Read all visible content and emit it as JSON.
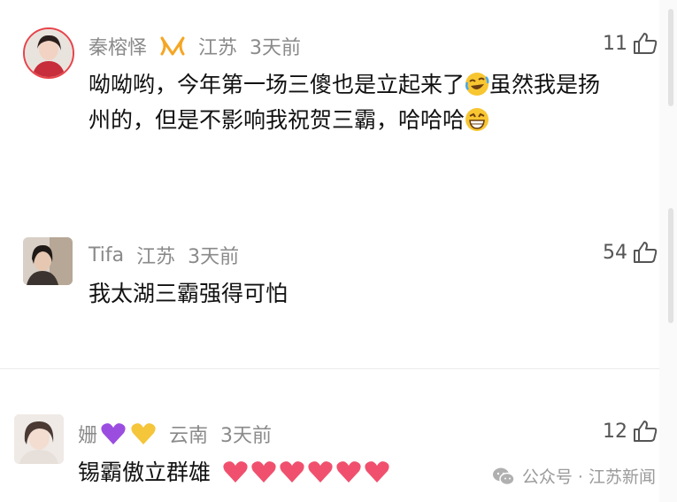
{
  "comments": [
    {
      "user": "秦榕怿",
      "location": "江苏",
      "time": "3天前",
      "likes": "11",
      "text_line1": "呦呦哟，今年第一场三傻也是立起来了",
      "text_line1b": "虽然我是扬",
      "text_line2": "州的，但是不影响我祝贺三霸，哈哈哈"
    },
    {
      "user": "Tifa",
      "location": "江苏",
      "time": "3天前",
      "likes": "54",
      "text": "我太湖三霸强得可怕"
    },
    {
      "user": "姗",
      "location": "云南",
      "time": "3天前",
      "likes": "12",
      "text": "锡霸傲立群雄"
    }
  ],
  "watermark": {
    "label": "公众号 · 江苏新闻"
  },
  "colors": {
    "meta": "#8a8a8a",
    "heart": "#f0506e",
    "purple_heart": "#9b4de0",
    "yellow_heart": "#f5c53a",
    "vip_badge": "#f5a623"
  }
}
